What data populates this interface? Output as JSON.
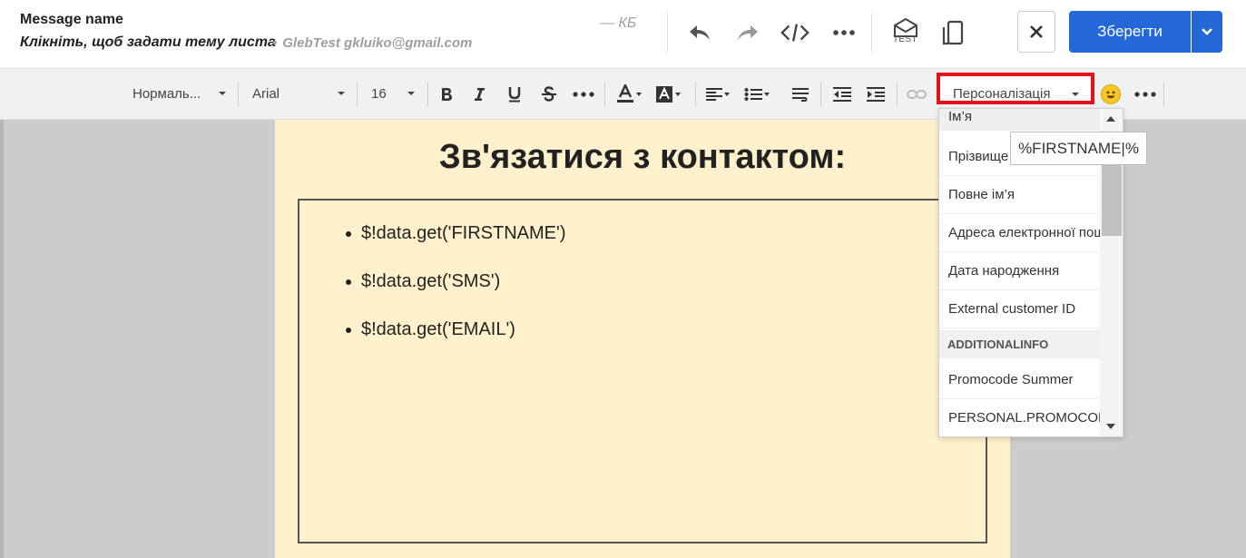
{
  "header": {
    "message_name": "Message name",
    "subject_prompt": "Клікніть, щоб задати тему листа",
    "sender": "GlebTest gkluiko@gmail.com",
    "sender_sep": "•",
    "size": "— КБ",
    "test_label": "TEST",
    "save_label": "Зберегти"
  },
  "toolbar": {
    "style": "Нормаль...",
    "font": "Arial",
    "size": "16",
    "personalization": "Персоналізація"
  },
  "canvas": {
    "heading": "Зв'язатися з контактом:",
    "items": [
      "$!data.get('FIRSTNAME')",
      "$!data.get('SMS')",
      "$!data.get('EMAIL')"
    ]
  },
  "dropdown": {
    "items": [
      "Ім’я",
      "Прізвище",
      "Повне ім’я",
      "Адреса електронної пошти",
      "Дата народження",
      "External customer ID"
    ],
    "group": "ADDITIONALINFO",
    "group_items": [
      "Promocode Summer",
      "PERSONAL.PROMOCODE"
    ],
    "tooltip": "%FIRSTNAME|%"
  },
  "colors": {
    "accent": "#2468d8",
    "highlight": "#e6101a",
    "paper": "#fff1cc"
  }
}
